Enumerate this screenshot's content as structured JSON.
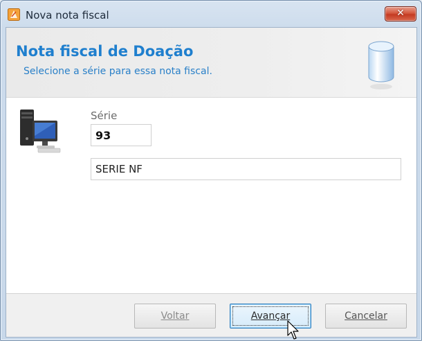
{
  "window": {
    "title": "Nova nota fiscal",
    "close_icon": "close-x"
  },
  "header": {
    "title": "Nota fiscal de Doação",
    "subtitle": "Selecione a série para essa nota fiscal.",
    "icon": "database-cylinder-icon"
  },
  "form": {
    "icon": "computer-workstation-icon",
    "serie_label": "Série",
    "serie_value": "93",
    "serie_description": "SERIE NF"
  },
  "buttons": {
    "back": {
      "label": "Voltar",
      "enabled": false
    },
    "next": {
      "label": "Avançar",
      "enabled": true,
      "focused": true
    },
    "cancel": {
      "label": "Cancelar",
      "enabled": true
    }
  },
  "colors": {
    "header_title": "#1f7fce",
    "header_subtitle": "#2a80c8",
    "close_button": "#c43a22",
    "focused_button_border": "#2f7fbe"
  }
}
